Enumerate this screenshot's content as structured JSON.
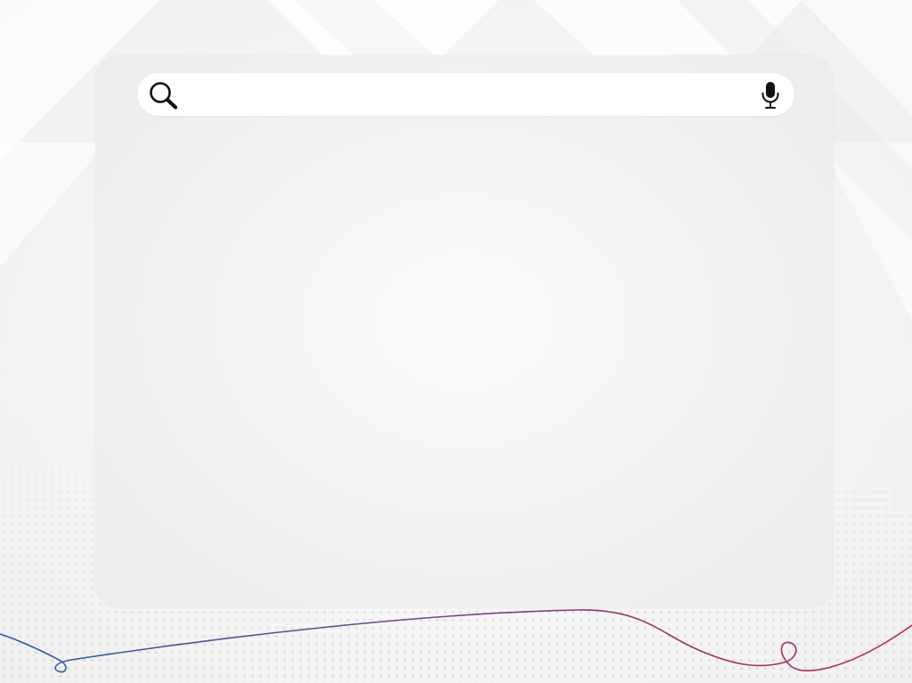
{
  "search": {
    "value": "",
    "placeholder": "",
    "search_icon": "search-icon",
    "mic_icon": "microphone-icon"
  },
  "colors": {
    "background": "#f4f4f4",
    "panel": "#f1f1f1",
    "search_bar": "#ffffff",
    "icon": "#111111",
    "curve_start": "#2f5fa8",
    "curve_end": "#c0283a"
  }
}
